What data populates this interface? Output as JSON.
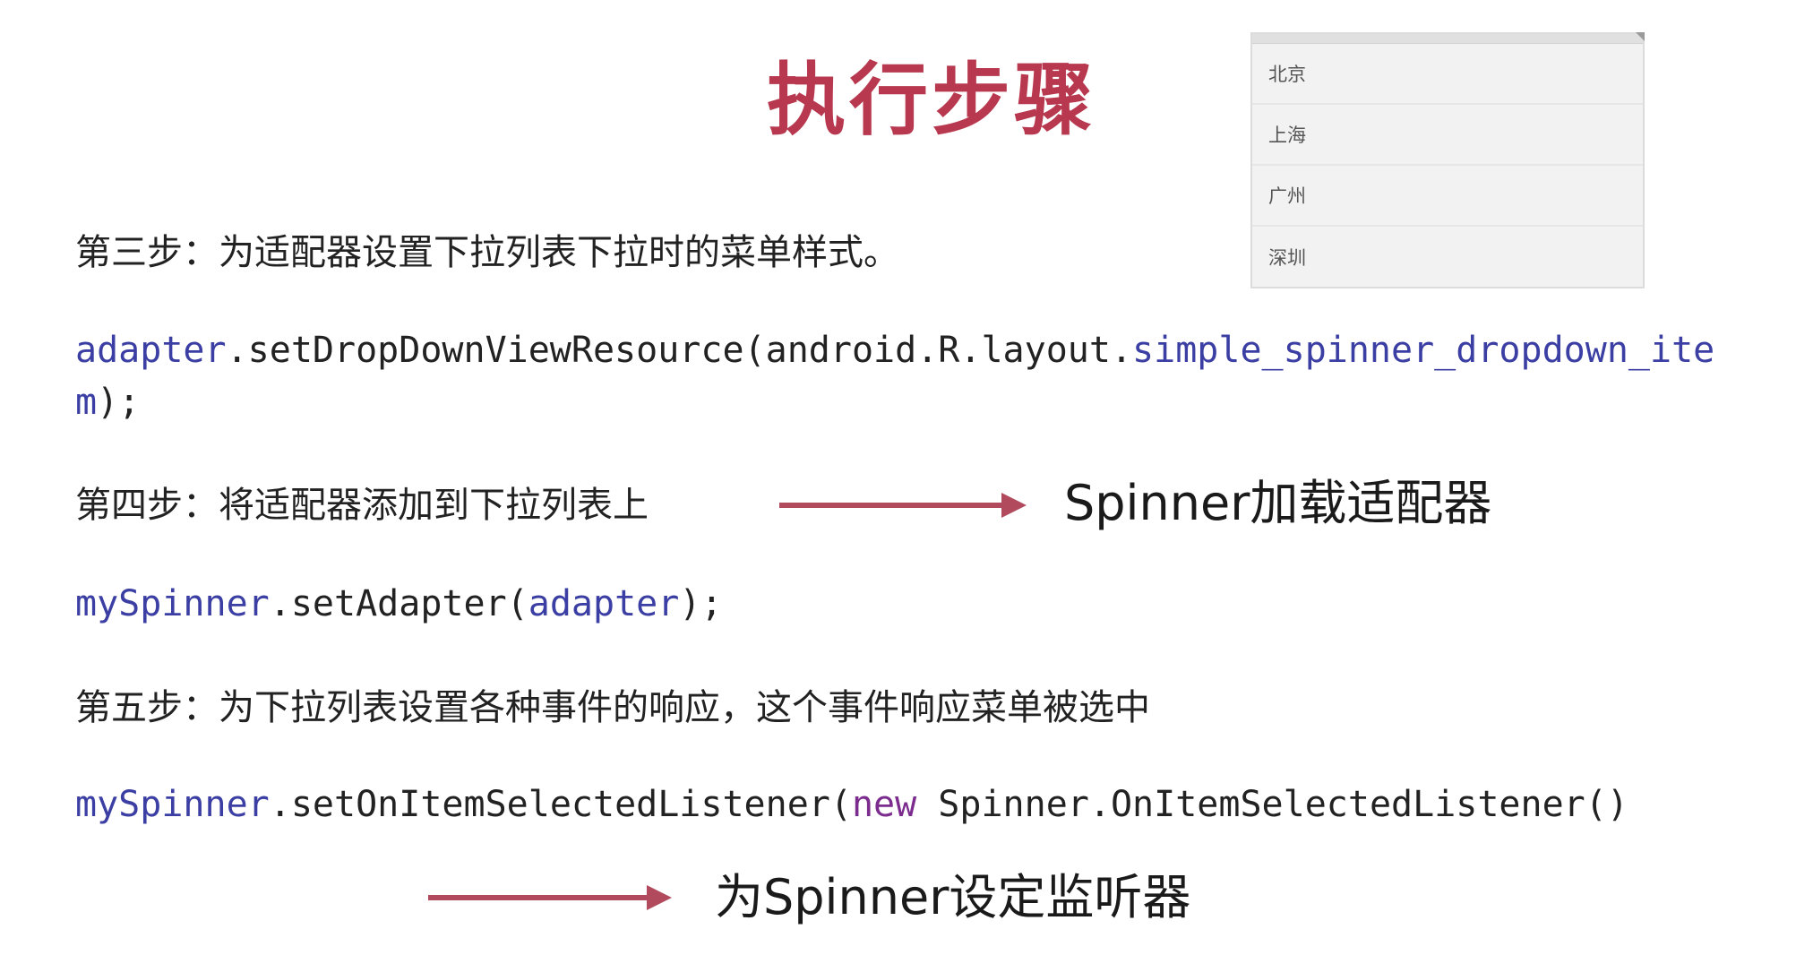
{
  "title": "执行步骤",
  "dropdown": {
    "items": [
      "北京",
      "上海",
      "广州",
      "深圳"
    ]
  },
  "step3": {
    "text": "第三步：为适配器设置下拉列表下拉时的菜单样式。",
    "code_line1": {
      "var": "adapter",
      "mid": ".setDropDownViewResource(android.R.layout.",
      "field": "simple_spinner_dropdown_ite"
    },
    "code_line2": {
      "field": "m",
      "end": ");"
    }
  },
  "step4": {
    "text": "第四步：将适配器添加到下拉列表上",
    "note": "Spinner加载适配器",
    "code": {
      "var": "mySpinner",
      "mid": ".setAdapter(",
      "arg": "adapter",
      "end": ");"
    }
  },
  "step5": {
    "text": "第五步：为下拉列表设置各种事件的响应，这个事件响应菜单被选中",
    "code": {
      "var": "mySpinner",
      "mid": ".setOnItemSelectedListener(",
      "kw": "new",
      "rest": " Spinner.OnItemSelectedListener()"
    },
    "note": "为Spinner设定监听器"
  },
  "colors": {
    "title": "#b8394f",
    "arrow": "#b24a5e",
    "code_identifier": "#3b3fa3",
    "code_keyword": "#7b2c8e"
  }
}
